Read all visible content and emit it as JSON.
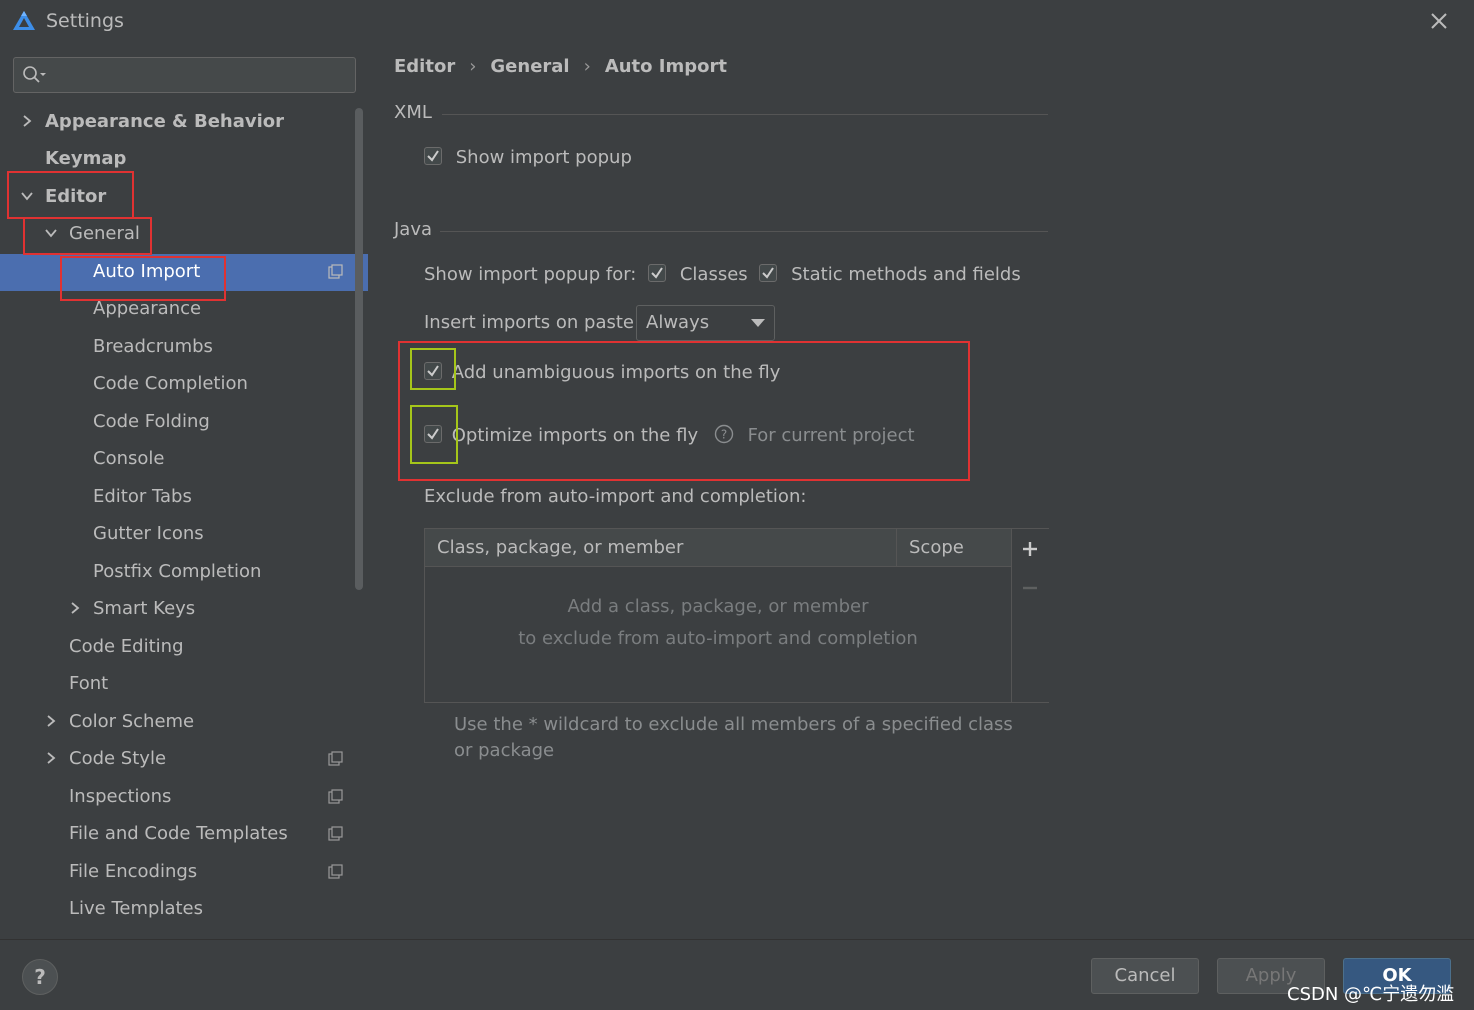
{
  "window": {
    "title": "Settings"
  },
  "search": {
    "placeholder": "",
    "value": ""
  },
  "sidebar": {
    "items": [
      {
        "label": "Appearance & Behavior"
      },
      {
        "label": "Keymap"
      },
      {
        "label": "Editor"
      },
      {
        "label": "General"
      },
      {
        "label": "Auto Import"
      },
      {
        "label": "Appearance"
      },
      {
        "label": "Breadcrumbs"
      },
      {
        "label": "Code Completion"
      },
      {
        "label": "Code Folding"
      },
      {
        "label": "Console"
      },
      {
        "label": "Editor Tabs"
      },
      {
        "label": "Gutter Icons"
      },
      {
        "label": "Postfix Completion"
      },
      {
        "label": "Smart Keys"
      },
      {
        "label": "Code Editing"
      },
      {
        "label": "Font"
      },
      {
        "label": "Color Scheme"
      },
      {
        "label": "Code Style"
      },
      {
        "label": "Inspections"
      },
      {
        "label": "File and Code Templates"
      },
      {
        "label": "File Encodings"
      },
      {
        "label": "Live Templates"
      }
    ],
    "selected": "Auto Import"
  },
  "breadcrumb": [
    "Editor",
    "General",
    "Auto Import"
  ],
  "xml": {
    "title": "XML",
    "show_import_popup": {
      "label": "Show import popup",
      "checked": true
    }
  },
  "java": {
    "title": "Java",
    "show_popup_for_label": "Show import popup for:",
    "classes": {
      "label": "Classes",
      "checked": true
    },
    "static_methods": {
      "label": "Static methods and fields",
      "checked": true
    },
    "insert_on_paste_label": "Insert imports on paste:",
    "insert_on_paste_value": "Always",
    "add_unambiguous": {
      "label": "Add unambiguous imports on the fly",
      "checked": true
    },
    "optimize_imports": {
      "label": "Optimize imports on the fly",
      "checked": true
    },
    "for_current_project": "For current project",
    "exclude_label": "Exclude from auto-import and completion:",
    "table": {
      "columns": [
        "Class, package, or member",
        "Scope"
      ],
      "empty_line1": "Add a class, package, or member",
      "empty_line2": "to exclude from auto-import and completion"
    },
    "hint": "Use the * wildcard to exclude all members of a specified class or package"
  },
  "footer": {
    "help": "?",
    "cancel": "Cancel",
    "apply": "Apply",
    "ok": "OK"
  },
  "watermark": "CSDN @℃宁遗勿滥",
  "colors": {
    "background": "#3c3f41",
    "selection": "#4b6eaf",
    "annotation_red": "#e03232",
    "annotation_green": "#a5c61a"
  }
}
